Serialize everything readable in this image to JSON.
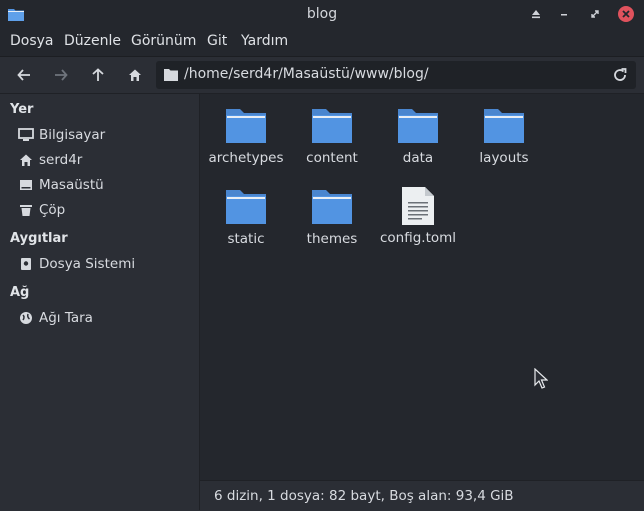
{
  "window": {
    "title": "blog"
  },
  "menubar": {
    "items": [
      "Dosya",
      "Düzenle",
      "Görünüm",
      "Git",
      "Yardım"
    ]
  },
  "toolbar": {
    "path": "/home/serd4r/Masaüstü/www/blog/"
  },
  "sidebar": {
    "sections": [
      {
        "title": "Yer",
        "items": [
          {
            "label": "Bilgisayar",
            "icon": "monitor-icon"
          },
          {
            "label": "serd4r",
            "icon": "home-icon"
          },
          {
            "label": "Masaüstü",
            "icon": "desktop-icon"
          },
          {
            "label": "Çöp",
            "icon": "trash-icon"
          }
        ]
      },
      {
        "title": "Aygıtlar",
        "items": [
          {
            "label": "Dosya Sistemi",
            "icon": "drive-icon"
          }
        ]
      },
      {
        "title": "Ağ",
        "items": [
          {
            "label": "Ağı Tara",
            "icon": "network-icon"
          }
        ]
      }
    ]
  },
  "files": [
    {
      "name": "archetypes",
      "type": "folder"
    },
    {
      "name": "content",
      "type": "folder"
    },
    {
      "name": "data",
      "type": "folder"
    },
    {
      "name": "layouts",
      "type": "folder"
    },
    {
      "name": "static",
      "type": "folder"
    },
    {
      "name": "themes",
      "type": "folder"
    },
    {
      "name": "config.toml",
      "type": "text-file"
    }
  ],
  "status": {
    "text": "6 dizin, 1 dosya: 82 bayt, Boş alan: 93,4 GiB"
  },
  "colors": {
    "folder": "#5294e2",
    "close": "#e0525d",
    "background": "#2b2e35",
    "content_bg": "#24272d"
  }
}
